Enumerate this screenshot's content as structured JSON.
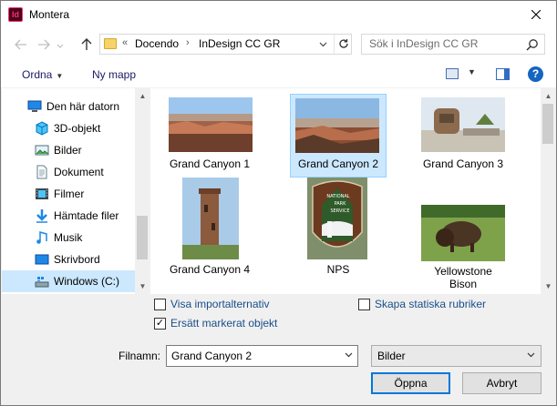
{
  "window": {
    "title": "Montera",
    "app_icon_text": "Id"
  },
  "nav": {
    "address": {
      "prefix": "«",
      "crumbs": [
        "Docendo",
        "InDesign CC GR"
      ],
      "separator": "›"
    },
    "search_placeholder": "Sök i InDesign CC GR"
  },
  "toolbar": {
    "organize_label": "Ordna",
    "new_folder_label": "Ny mapp",
    "help_label": "?"
  },
  "sidebar": {
    "items": [
      {
        "label": "Den här datorn",
        "icon": "computer-icon"
      },
      {
        "label": "3D-objekt",
        "icon": "cube-icon"
      },
      {
        "label": "Bilder",
        "icon": "pictures-icon"
      },
      {
        "label": "Dokument",
        "icon": "document-icon"
      },
      {
        "label": "Filmer",
        "icon": "film-icon"
      },
      {
        "label": "Hämtade filer",
        "icon": "download-icon"
      },
      {
        "label": "Musik",
        "icon": "music-icon"
      },
      {
        "label": "Skrivbord",
        "icon": "desktop-icon"
      },
      {
        "label": "Windows (C:)",
        "icon": "drive-icon"
      }
    ]
  },
  "files": [
    {
      "name": "Grand Canyon 1"
    },
    {
      "name": "Grand Canyon 2"
    },
    {
      "name": "Grand Canyon 3"
    },
    {
      "name": "Grand Canyon 4"
    },
    {
      "name": "NPS",
      "sign_lines": [
        "NATIONAL",
        "PARK",
        "SERVICE"
      ]
    },
    {
      "name_line1": "Yellowstone",
      "name_line2": "Bison"
    }
  ],
  "options": {
    "show_import": {
      "label": "Visa importalternativ",
      "checked": false
    },
    "create_captions": {
      "label": "Skapa statiska rubriker",
      "checked": false
    },
    "replace_selected": {
      "label": "Ersätt markerat objekt",
      "checked": true,
      "mark": "✓"
    }
  },
  "footer": {
    "filename_label": "Filnamn:",
    "filename_value": "Grand Canyon 2",
    "filter_value": "Bilder",
    "open_label": "Öppna",
    "cancel_label": "Avbryt"
  },
  "colors": {
    "selection": "#cce8ff",
    "accent": "#0078d7"
  }
}
